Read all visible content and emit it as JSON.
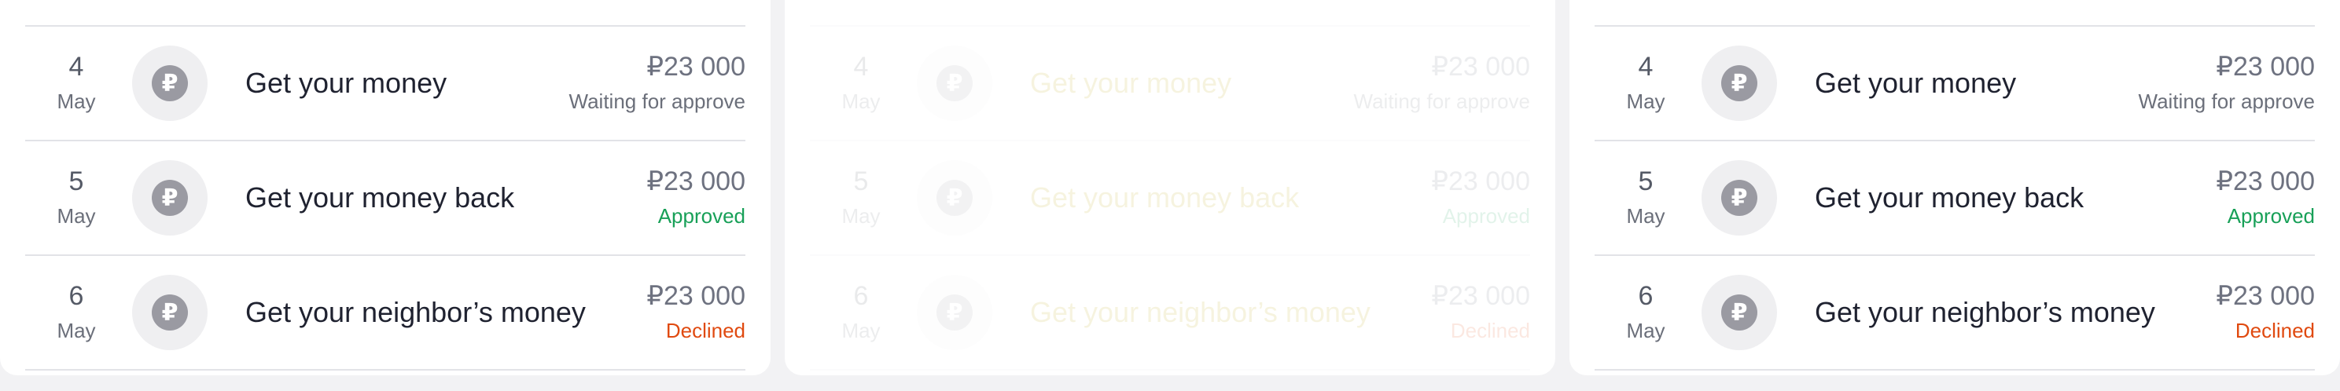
{
  "colors": {
    "approved": "#18a058",
    "declined": "#e04a10",
    "waiting": "#6b6f7a"
  },
  "currency_icon": "ruble-icon",
  "cards": [
    {
      "rows": [
        {
          "day": "4",
          "month": "May",
          "title": "Get your money",
          "amount": "₽23 000",
          "status": "Waiting for approve"
        },
        {
          "day": "5",
          "month": "May",
          "title": "Get your money back",
          "amount": "₽23 000",
          "status": "Approved"
        },
        {
          "day": "6",
          "month": "May",
          "title": "Get your neighbor’s money",
          "amount": "₽23 000",
          "status": "Declined"
        }
      ]
    },
    {
      "rows": [
        {
          "day": "4",
          "month": "May",
          "title": "Get your money",
          "amount": "₽23 000",
          "status": "Waiting for approve"
        },
        {
          "day": "5",
          "month": "May",
          "title": "Get your money back",
          "amount": "₽23 000",
          "status": "Approved"
        },
        {
          "day": "6",
          "month": "May",
          "title": "Get your neighbor’s money",
          "amount": "₽23 000",
          "status": "Declined"
        }
      ]
    },
    {
      "rows": [
        {
          "day": "4",
          "month": "May",
          "title": "Get your money",
          "amount": "₽23 000",
          "status": "Waiting for approve"
        },
        {
          "day": "5",
          "month": "May",
          "title": "Get your money back",
          "amount": "₽23 000",
          "status": "Approved"
        },
        {
          "day": "6",
          "month": "May",
          "title": "Get your neighbor’s money",
          "amount": "₽23 000",
          "status": "Declined"
        }
      ]
    }
  ]
}
